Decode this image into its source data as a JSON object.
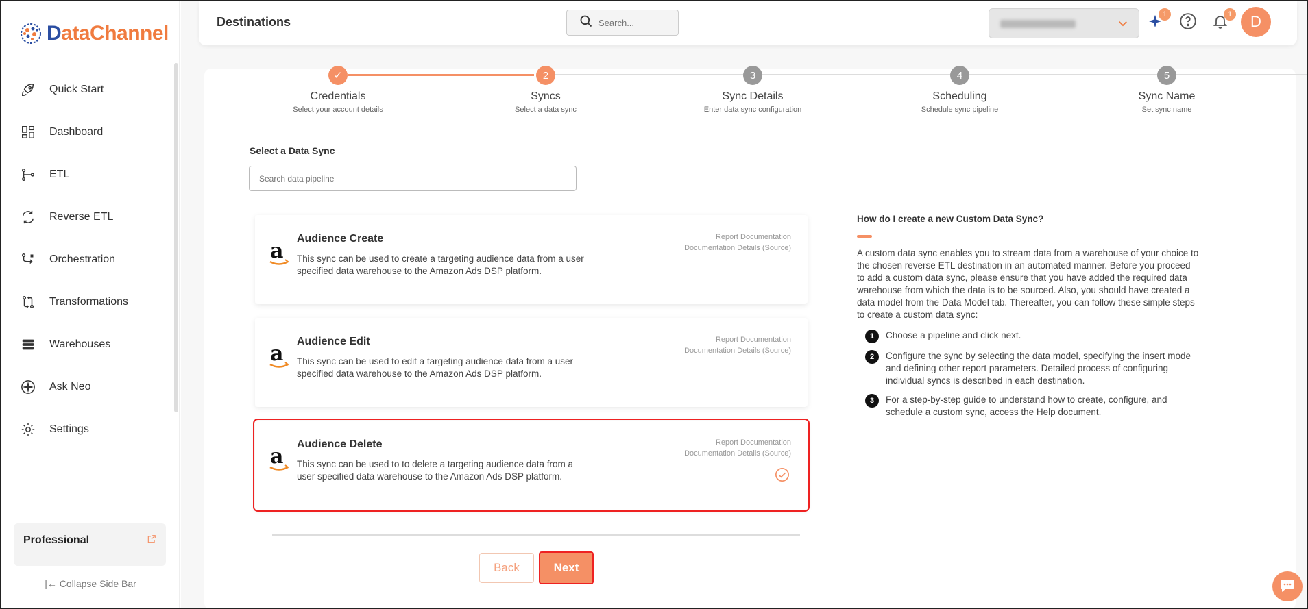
{
  "app": {
    "brand_prefix": "D",
    "brand_rest": "ataChannel"
  },
  "sidebar": {
    "items": [
      {
        "label": "Quick Start",
        "icon": "rocket-icon"
      },
      {
        "label": "Dashboard",
        "icon": "dashboard-icon"
      },
      {
        "label": "ETL",
        "icon": "etl-icon"
      },
      {
        "label": "Reverse ETL",
        "icon": "reverse-etl-icon"
      },
      {
        "label": "Orchestration",
        "icon": "orchestration-icon"
      },
      {
        "label": "Transformations",
        "icon": "transformations-icon"
      },
      {
        "label": "Warehouses",
        "icon": "warehouses-icon"
      },
      {
        "label": "Ask Neo",
        "icon": "sparkle-icon"
      },
      {
        "label": "Settings",
        "icon": "gear-icon"
      }
    ],
    "plan": "Professional",
    "collapse_label": "Collapse Side Bar"
  },
  "header": {
    "title": "Destinations",
    "search_placeholder": "Search...",
    "neo_badge": "1",
    "notif_badge": "1",
    "avatar_initial": "D"
  },
  "stepper": [
    {
      "num": "✓",
      "name": "Credentials",
      "sub": "Select your account details",
      "state": "done"
    },
    {
      "num": "2",
      "name": "Syncs",
      "sub": "Select a data sync",
      "state": "active"
    },
    {
      "num": "3",
      "name": "Sync Details",
      "sub": "Enter data sync configuration",
      "state": "pending"
    },
    {
      "num": "4",
      "name": "Scheduling",
      "sub": "Schedule sync pipeline",
      "state": "pending"
    },
    {
      "num": "5",
      "name": "Sync Name",
      "sub": "Set sync name",
      "state": "pending"
    }
  ],
  "sync_select": {
    "label": "Select a Data Sync",
    "search_placeholder": "Search data pipeline"
  },
  "cards": [
    {
      "title": "Audience Create",
      "desc": "This sync can be used to create a targeting audience data from a user specified data warehouse to the Amazon Ads DSP platform.",
      "link1": "Report Documentation",
      "link2": "Documentation Details (Source)",
      "selected": false
    },
    {
      "title": "Audience Edit",
      "desc": "This sync can be used to edit a targeting audience data from a user specified data warehouse to the Amazon Ads DSP platform.",
      "link1": "Report Documentation",
      "link2": "Documentation Details (Source)",
      "selected": false
    },
    {
      "title": "Audience Delete",
      "desc": "This sync can be used to to delete a targeting audience data from a user specified data warehouse to the Amazon Ads DSP platform.",
      "link1": "Report Documentation",
      "link2": "Documentation Details (Source)",
      "selected": true
    }
  ],
  "buttons": {
    "back": "Back",
    "next": "Next"
  },
  "help": {
    "title": "How do I create a new Custom Data Sync?",
    "body": "A custom data sync enables you to stream data from a warehouse of your choice to the chosen reverse ETL destination in an automated manner. Before you proceed to add a custom data sync, please ensure that you have added the required data warehouse from which the data is to be sourced. Also, you should have created a data model from the Data Model tab. Thereafter, you can follow these simple steps to create a custom data sync:",
    "steps": [
      {
        "num": "1",
        "text": "Choose a pipeline and click next."
      },
      {
        "num": "2",
        "text": "Configure the sync by selecting the data model, specifying the insert mode and defining other report parameters. Detailed process of configuring individual syncs is described in each destination."
      },
      {
        "num": "3",
        "text": "For a step-by-step guide to understand how to create, configure, and schedule a custom sync, access the Help document."
      }
    ]
  },
  "colors": {
    "accent": "#f59065",
    "brand_blue": "#2b4ea2",
    "selected_outline": "#e22222"
  }
}
